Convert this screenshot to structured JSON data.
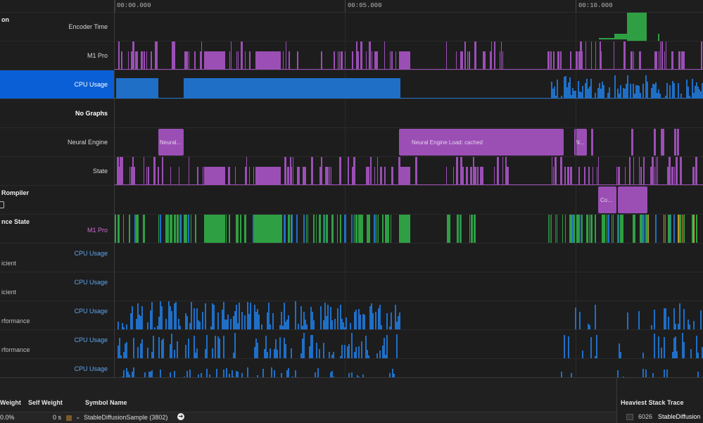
{
  "ruler": {
    "ticks": [
      "00:00.000",
      "00:05.000",
      "00:10.000"
    ]
  },
  "tracks": [
    {
      "title": "on",
      "name": "Encoder Time",
      "style": "normal"
    },
    {
      "title": "",
      "name": "M1 Pro",
      "style": "normal"
    },
    {
      "title": "",
      "name": "CPU Usage",
      "style": "normal",
      "selected": true
    },
    {
      "title": "",
      "name": "No Graphs",
      "style": "bold"
    },
    {
      "title": "",
      "name": "Neural Engine",
      "style": "normal"
    },
    {
      "title": "",
      "name": "State",
      "style": "normal"
    },
    {
      "title": "Rompiler",
      "name": "",
      "style": "normal",
      "checkbox": true
    },
    {
      "title": "nce State",
      "name": "M1 Pro",
      "style": "purple"
    },
    {
      "sub": "icient",
      "name": "CPU Usage",
      "style": "blue"
    },
    {
      "sub": "icient",
      "name": "CPU Usage",
      "style": "blue"
    },
    {
      "sub": "rformance",
      "name": "CPU Usage",
      "style": "blue"
    },
    {
      "sub": "rformance",
      "name": "CPU Usage",
      "style": "blue"
    },
    {
      "sub": "rformance",
      "name": "CPU Usage",
      "style": "blue"
    }
  ],
  "neural_engine_labels": [
    "Neural...",
    "Neural Engine Load: cached",
    "N..."
  ],
  "compiler_labels": [
    "Co..."
  ],
  "bottom": {
    "columns": {
      "weight": "Weight",
      "self_weight": "Self Weight",
      "symbol_name": "Symbol Name"
    },
    "row": {
      "weight": "0.0%",
      "self_weight": "0 s",
      "symbol": "StableDiffusionSample (3802)"
    },
    "heaviest": {
      "title": "Heaviest Stack Trace",
      "count": "6026",
      "symbol": "StableDiffusion"
    }
  },
  "colors": {
    "purple": "#9b4fb5",
    "blue": "#1f6fc7",
    "green": "#2ea043",
    "selected": "#0a5fd6",
    "orange": "#c9962a"
  }
}
